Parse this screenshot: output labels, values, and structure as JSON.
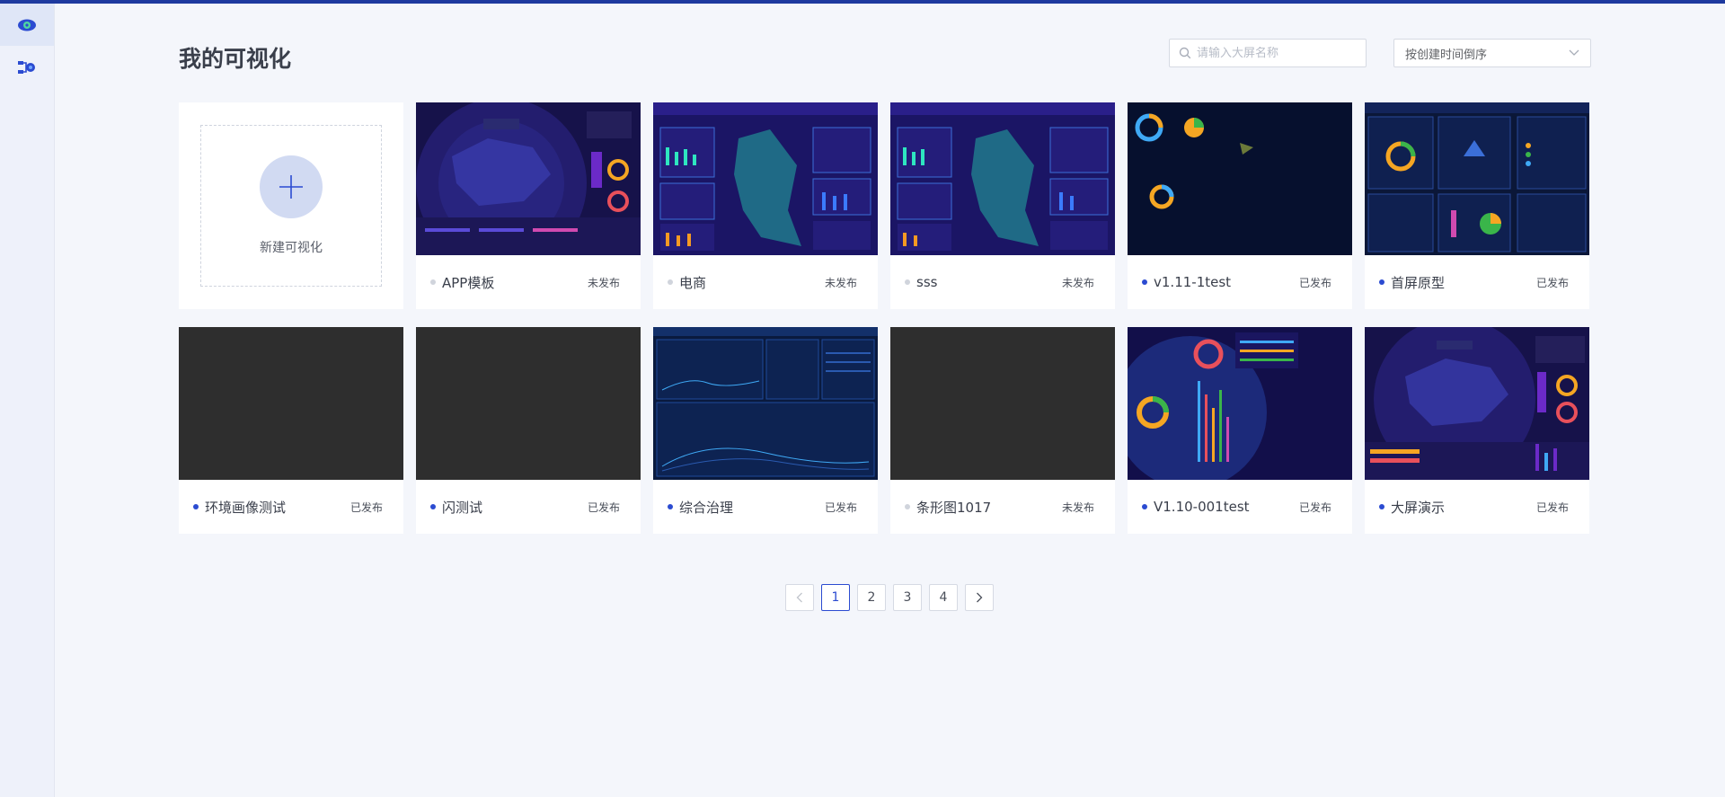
{
  "page": {
    "title": "我的可视化"
  },
  "search": {
    "placeholder": "请输入大屏名称",
    "value": ""
  },
  "sort": {
    "selected": "按创建时间倒序"
  },
  "new_card": {
    "label": "新建可视化"
  },
  "cards": [
    {
      "name": "APP模板",
      "status": "未发布",
      "published": false,
      "thumb": "map-purple"
    },
    {
      "name": "电商",
      "status": "未发布",
      "published": false,
      "thumb": "map-region"
    },
    {
      "name": "sss",
      "status": "未发布",
      "published": false,
      "thumb": "map-region"
    },
    {
      "name": "v1.11-1test",
      "status": "已发布",
      "published": true,
      "thumb": "dark-donuts"
    },
    {
      "name": "首屏原型",
      "status": "已发布",
      "published": true,
      "thumb": "dashboard-panels"
    },
    {
      "name": "环境画像测试",
      "status": "已发布",
      "published": true,
      "thumb": "empty-gray"
    },
    {
      "name": "闪测试",
      "status": "已发布",
      "published": true,
      "thumb": "empty-gray"
    },
    {
      "name": "综合治理",
      "status": "已发布",
      "published": true,
      "thumb": "governance"
    },
    {
      "name": "条形图1017",
      "status": "未发布",
      "published": false,
      "thumb": "empty-gray"
    },
    {
      "name": "V1.10-001test",
      "status": "已发布",
      "published": true,
      "thumb": "globe-bars"
    },
    {
      "name": "大屏演示",
      "status": "已发布",
      "published": true,
      "thumb": "map-purple2"
    }
  ],
  "pagination": {
    "pages": [
      "1",
      "2",
      "3",
      "4"
    ],
    "current": "1"
  },
  "colors": {
    "accent": "#2b4bd1",
    "topbar": "#1e3a9f"
  },
  "icons": {
    "sidebar": [
      "eye-icon",
      "flow-icon"
    ],
    "search": "search-icon",
    "sort": "chevron-down-icon"
  }
}
